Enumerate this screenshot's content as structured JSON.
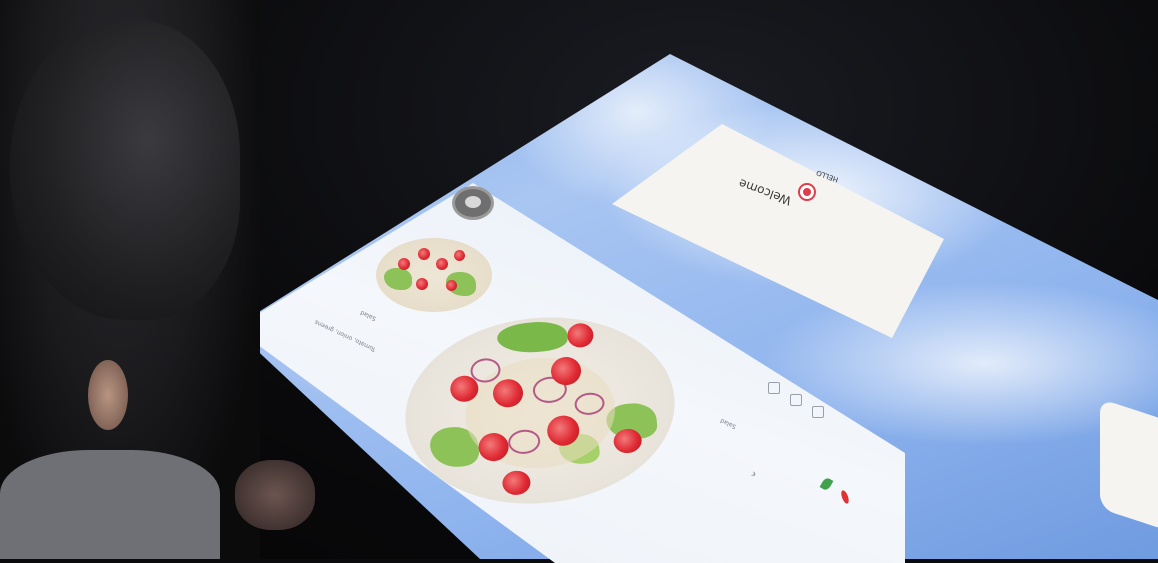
{
  "welcome_card": {
    "title": "Welcome",
    "tag": "HELLO"
  },
  "menu_panel": {
    "item_small_caption": "Salad",
    "item_description": "Tomato, onion, greens",
    "price_label": "€"
  },
  "icons": {
    "welcome_icon": "badge-icon",
    "avatar": "user-avatar-icon",
    "leaf": "vegetarian-leaf-icon",
    "chili": "spicy-chili-icon"
  },
  "colors": {
    "accent_red": "#e23b4a",
    "sky_blue": "#8fb4ee",
    "veg_green": "#3fa34d"
  }
}
